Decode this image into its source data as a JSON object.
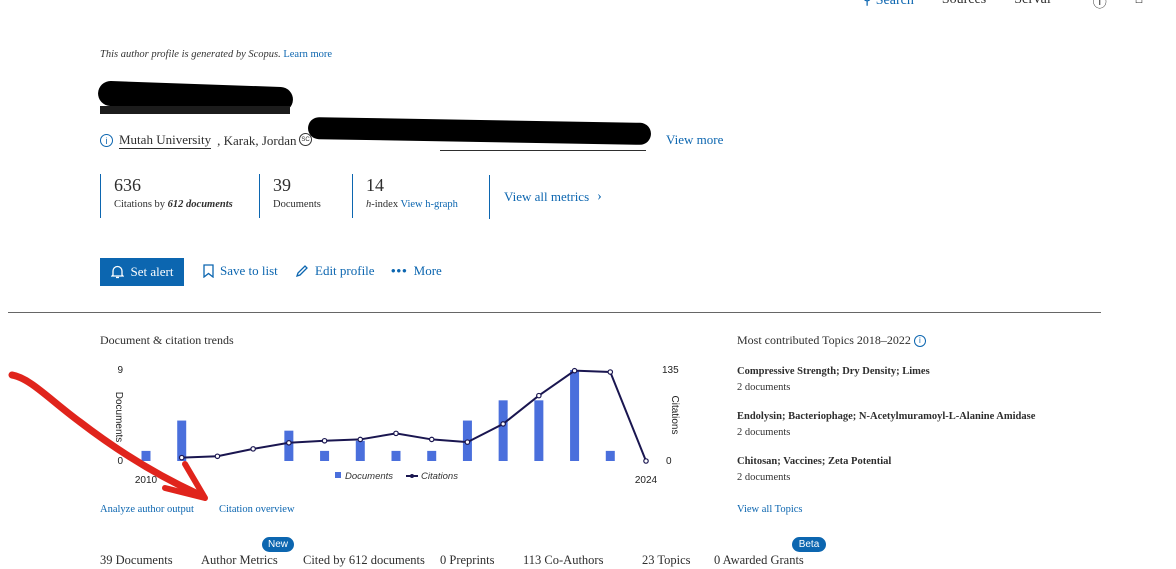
{
  "topnav": {
    "search": "Search",
    "sources": "Sources",
    "scival": "SciVal"
  },
  "notice": {
    "text": "This author profile is generated by Scopus.",
    "link": "Learn more"
  },
  "author": {
    "affiliation": "Mutah University",
    "location": ", Karak, Jordan",
    "view_more": "View more"
  },
  "metrics": [
    {
      "value": "636",
      "label_pre": "Citations by ",
      "label_em": "612 documents",
      "label_post": ""
    },
    {
      "value": "39",
      "label_pre": "Documents",
      "label_em": "",
      "label_post": ""
    },
    {
      "value": "14",
      "label_pre": "",
      "label_em": "h",
      "label_post": "-index ",
      "link": "View h-graph"
    }
  ],
  "view_all_metrics": "View all metrics",
  "actions": {
    "set_alert": "Set alert",
    "save_to_list": "Save to list",
    "edit_profile": "Edit profile",
    "more": "More"
  },
  "trends": {
    "title": "Document & citation trends",
    "analyze_link": "Analyze author output",
    "citation_link": "Citation overview"
  },
  "chart_data": {
    "type": "bar",
    "x": [
      2010,
      2011,
      2012,
      2013,
      2014,
      2015,
      2016,
      2017,
      2018,
      2019,
      2020,
      2021,
      2022,
      2023,
      2024
    ],
    "xticks": [
      "2010",
      "2024"
    ],
    "series": [
      {
        "name": "Documents",
        "type": "bar",
        "axis": "left",
        "color": "#4a6fdc",
        "values": [
          1,
          4,
          0,
          0,
          3,
          1,
          2,
          1,
          1,
          4,
          6,
          6,
          9,
          1,
          0
        ]
      },
      {
        "name": "Citations",
        "type": "line",
        "axis": "right",
        "color": "#1a1650",
        "values": [
          5,
          7,
          18,
          27,
          30,
          32,
          41,
          32,
          28,
          55,
          97,
          134,
          132,
          0,
          null
        ]
      }
    ],
    "ylabel_left": "Documents",
    "ylabel_right": "Citations",
    "ylim_left": [
      0,
      9
    ],
    "ylim_right": [
      0,
      135
    ],
    "yticks_left": [
      "0",
      "9"
    ],
    "yticks_right": [
      "0",
      "135"
    ],
    "legend_position": "bottom"
  },
  "topics": {
    "title": "Most contributed Topics 2018–2022",
    "items": [
      {
        "name": "Compressive Strength; Dry Density; Limes",
        "count": "2 documents"
      },
      {
        "name": "Endolysin; Bacteriophage; N-Acetylmuramoyl-L-Alanine Amidase",
        "count": "2 documents"
      },
      {
        "name": "Chitosan; Vaccines; Zeta Potential",
        "count": "2 documents"
      }
    ],
    "view_all": "View all Topics"
  },
  "tabs": [
    {
      "label": "39 Documents"
    },
    {
      "label": "Author Metrics",
      "badge": "New"
    },
    {
      "label": "Cited by 612 documents"
    },
    {
      "label": "0 Preprints"
    },
    {
      "label": "113 Co-Authors"
    },
    {
      "label": "23 Topics"
    },
    {
      "label": "0 Awarded Grants",
      "badge": "Beta"
    }
  ],
  "colors": {
    "accent": "#0c66b0",
    "bar": "#4a6fdc",
    "line": "#1a1650",
    "annotation": "#e0241c"
  }
}
